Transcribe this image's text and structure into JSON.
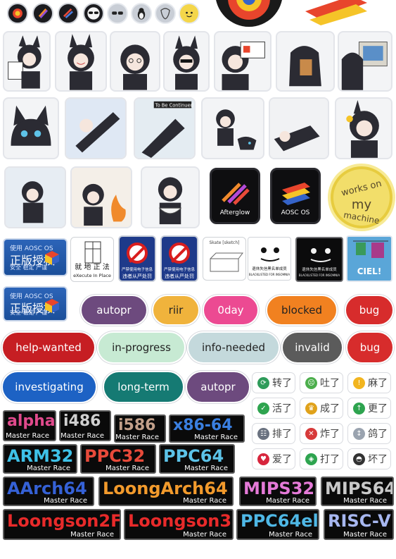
{
  "emblems": [
    "aosc-round-icon",
    "afterglow-round-icon",
    "aosc-alt-round-icon",
    "sunglasses-round-icon",
    "sunglasses-outline-icon",
    "linux-penguin-icon",
    "gnu-head-icon",
    "yellow-mascot-icon"
  ],
  "app_icons": {
    "afterglow": "Afterglow",
    "aosc": "AOSC OS"
  },
  "seal": {
    "line1": "works on",
    "line2": "my",
    "line3": "machine"
  },
  "license": {
    "head": "使用 AOSC OS",
    "main": "正版授权",
    "sub": "安全 稳定 严谨"
  },
  "execute_sign": {
    "hanzi": "就 地 正 法",
    "caption": "eXecute In Place"
  },
  "prohib_sign": {
    "line1": "严禁使用电子信息",
    "line2": "违者从严处罚"
  },
  "sketch_sign": {
    "title": "Skate [sketch]"
  },
  "blacklist": {
    "line1": "退休失信黑名单成员",
    "line2": "BLACKLISTED FOR INSOMNIA"
  },
  "ciel": {
    "label": "CIEL!"
  },
  "pills": [
    {
      "text": "autopr",
      "bg": "#6d4a7e",
      "fg": "#ffffff"
    },
    {
      "text": "riir",
      "bg": "#f0b33c",
      "fg": "#222222"
    },
    {
      "text": "0day",
      "bg": "#ec4a92",
      "fg": "#ffffff"
    },
    {
      "text": "blocked",
      "bg": "#f18120",
      "fg": "#222222"
    },
    {
      "text": "bug",
      "bg": "#d72c2c",
      "fg": "#ffffff"
    },
    {
      "text": "help-wanted",
      "bg": "#c61e23",
      "fg": "#ffffff"
    },
    {
      "text": "in-progress",
      "bg": "#c7ead3",
      "fg": "#222222"
    },
    {
      "text": "info-needed",
      "bg": "#c4d9dc",
      "fg": "#222222"
    },
    {
      "text": "invalid",
      "bg": "#5b5b5b",
      "fg": "#ffffff"
    },
    {
      "text": "bug",
      "bg": "#d72c2c",
      "fg": "#ffffff"
    },
    {
      "text": "investigating",
      "bg": "#1d62c4",
      "fg": "#ffffff"
    },
    {
      "text": "long-term",
      "bg": "#157a73",
      "fg": "#ffffff"
    },
    {
      "text": "autopr",
      "bg": "#6d4a7e",
      "fg": "#ffffff"
    }
  ],
  "chips": [
    {
      "icon": "⟳",
      "icon_bg": "#2e9b5a",
      "text": "转了"
    },
    {
      "icon": "☹",
      "icon_bg": "#4cae4c",
      "text": "吐了"
    },
    {
      "icon": "!",
      "icon_bg": "#f2b51f",
      "text": "麻了"
    },
    {
      "icon": "✓",
      "icon_bg": "#2ea44f",
      "text": "活了"
    },
    {
      "icon": "♛",
      "icon_bg": "#e0a21b",
      "text": "成了"
    },
    {
      "icon": "↑",
      "icon_bg": "#2ea44f",
      "text": "更了"
    },
    {
      "icon": "☷",
      "icon_bg": "#6a7280",
      "text": "排了"
    },
    {
      "icon": "✕",
      "icon_bg": "#d73a3a",
      "text": "炸了"
    },
    {
      "icon": "↕",
      "icon_bg": "#9aa3af",
      "text": "鸽了"
    },
    {
      "icon": "♥",
      "icon_bg": "#d7263d",
      "text": "爱了"
    },
    {
      "icon": "◈",
      "icon_bg": "#2ea44f",
      "text": "打了"
    },
    {
      "icon": "◓",
      "icon_bg": "#333333",
      "text": "坏了"
    }
  ],
  "master_race": {
    "subtitle": "Master Race",
    "items": [
      {
        "name": "alpha",
        "color": "#e04a8c"
      },
      {
        "name": "i486",
        "color": "#d0d0d0"
      },
      {
        "name": "i586",
        "color": "#c2a08a"
      },
      {
        "name": "x86-64",
        "color": "#3a7fe0"
      },
      {
        "name": "ARM32",
        "color": "#3ec1e8"
      },
      {
        "name": "PPC32",
        "color": "#e84a3a"
      },
      {
        "name": "PPC64",
        "color": "#5cc3e8"
      },
      {
        "name": "AArch64",
        "color": "#3561d6"
      },
      {
        "name": "LoongArch64",
        "color": "#f29a2c"
      },
      {
        "name": "MIPS32",
        "color": "#e57ad8"
      },
      {
        "name": "MIPS64",
        "color": "#c9c9c9"
      },
      {
        "name": "Loongson2F",
        "color": "#e82a2a"
      },
      {
        "name": "Loongson3",
        "color": "#e82a2a"
      },
      {
        "name": "PPC64el",
        "color": "#4fb8e6"
      },
      {
        "name": "RISC-V",
        "color": "#a7b7f0"
      }
    ]
  }
}
